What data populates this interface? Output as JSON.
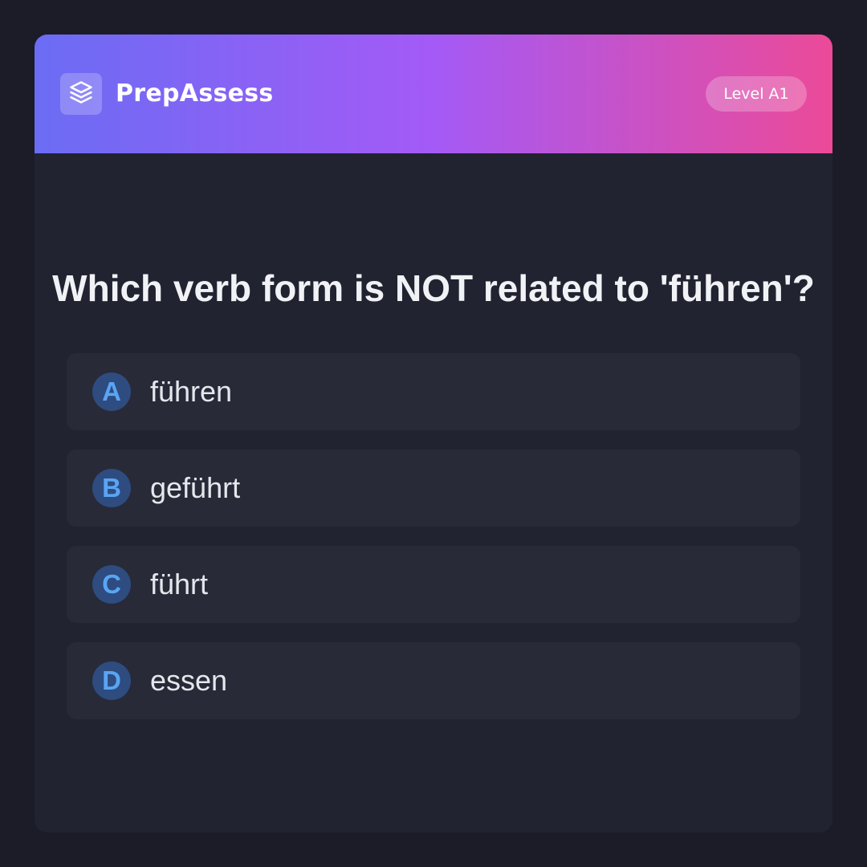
{
  "header": {
    "app_name": "PrepAssess",
    "logo_icon": "layers-icon",
    "level": "Level A1",
    "gradient": [
      "#6b6cf4",
      "#a45af6",
      "#ec4a98"
    ]
  },
  "question": {
    "text": "Which verb form is NOT related to 'führen'?"
  },
  "options": [
    {
      "letter": "A",
      "text": "führen"
    },
    {
      "letter": "B",
      "text": "geführt"
    },
    {
      "letter": "C",
      "text": "führt"
    },
    {
      "letter": "D",
      "text": "essen"
    }
  ],
  "colors": {
    "background": "#1b1c28",
    "card": "#212331",
    "option_bg": "#282a38",
    "badge_bg": "#2e4c7f",
    "badge_text": "#5aa4f4"
  }
}
